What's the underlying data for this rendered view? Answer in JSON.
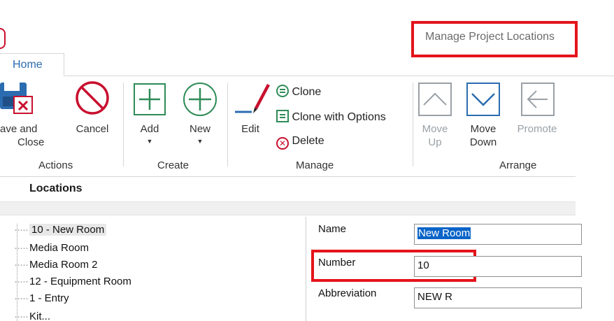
{
  "window": {
    "title": "Manage Project Locations"
  },
  "tabs": {
    "home": "Home"
  },
  "ribbon": {
    "actions": {
      "group_label": "Actions",
      "save_and_close_line1": "ave and",
      "save_and_close_line2": "Close",
      "cancel": "Cancel"
    },
    "create": {
      "group_label": "Create",
      "add": "Add",
      "new": "New"
    },
    "manage": {
      "group_label": "Manage",
      "edit": "Edit",
      "clone": "Clone",
      "clone_with_options": "Clone with Options",
      "delete": "Delete"
    },
    "arrange": {
      "group_label": "Arrange",
      "move_up_line1": "Move",
      "move_up_line2": "Up",
      "move_down_line1": "Move",
      "move_down_line2": "Down",
      "promote": "Promote"
    }
  },
  "locations": {
    "header": "Locations",
    "tree": [
      "10 - New Room",
      "Media Room",
      "Media Room 2",
      "12 - Equipment Room",
      "1 - Entry",
      "Kit..."
    ]
  },
  "form": {
    "name_label": "Name",
    "name_value": "New Room",
    "number_label": "Number",
    "number_value": "10",
    "abbreviation_label": "Abbreviation",
    "abbreviation_value": "NEW R"
  },
  "colors": {
    "accent_blue": "#2b6cb0",
    "highlight_red": "#e4141b",
    "create_green": "#2e8b57",
    "cancel_red": "#c8102e"
  }
}
